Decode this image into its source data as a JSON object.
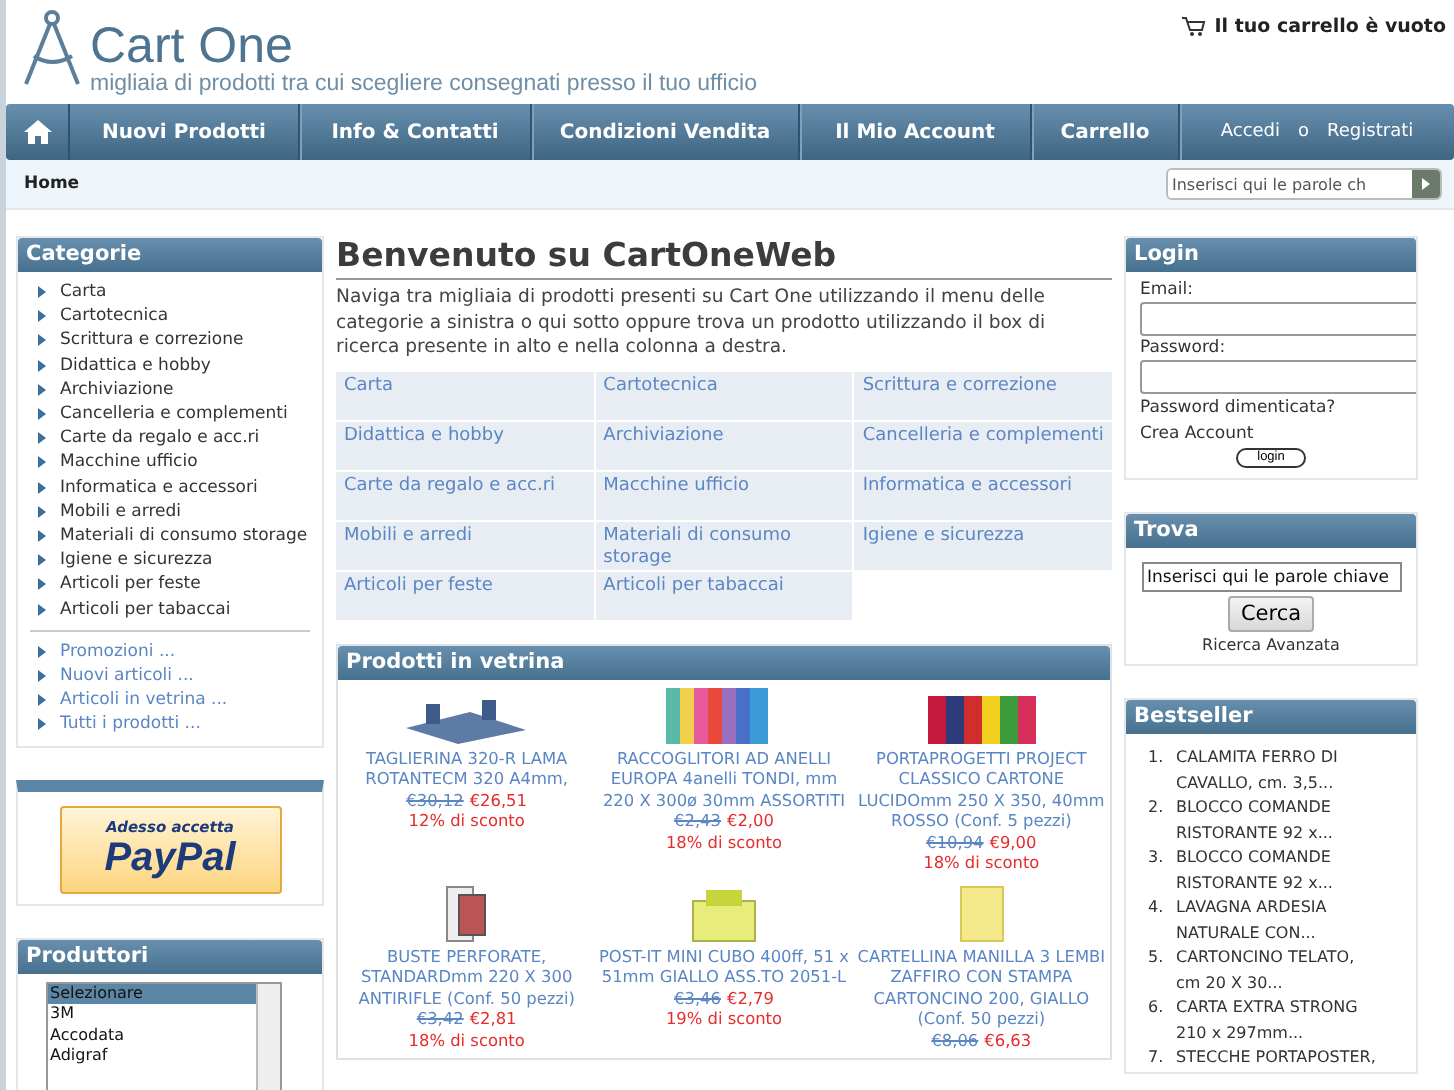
{
  "header": {
    "logo": "Cart One",
    "tagline": "migliaia di prodotti tra cui scegliere consegnati presso il tuo ufficio",
    "cart": "Il tuo carrello è vuoto"
  },
  "nav": {
    "items": [
      "Nuovi Prodotti",
      "Info & Contatti",
      "Condizioni Vendita",
      "Il Mio Account",
      "Carrello"
    ],
    "login": "Accedi",
    "separator": "o",
    "register": "Registrati"
  },
  "breadcrumb": "Home",
  "top_search": {
    "placeholder": "Inserisci qui le parole ch"
  },
  "categories": {
    "title": "Categorie",
    "items": [
      {
        "label": "Carta"
      },
      {
        "label": "Cartotecnica"
      },
      {
        "label": "Scrittura e correzione"
      },
      {
        "label": "Didattica e hobby"
      },
      {
        "label": "Archiviazione"
      },
      {
        "label": "Cancelleria e complementi"
      },
      {
        "label": "Carte da regalo e acc.ri"
      },
      {
        "label": "Macchine ufficio"
      },
      {
        "label": "Informatica e accessori"
      },
      {
        "label": "Mobili e arredi"
      },
      {
        "label": "Materiali di consumo storage"
      },
      {
        "label": "Igiene e sicurezza"
      },
      {
        "label": "Articoli per feste"
      },
      {
        "label": "Articoli per tabaccai"
      }
    ],
    "links": [
      "Promozioni ...",
      "Nuovi articoli ...",
      "Articoli in vetrina ...",
      "Tutti i prodotti ..."
    ]
  },
  "paypal": {
    "line1": "Adesso accetta",
    "line2": "PayPal"
  },
  "manufacturers": {
    "title": "Produttori",
    "options": [
      {
        "label": "Selezionare",
        "selected": true
      },
      {
        "label": "3M",
        "selected": false
      },
      {
        "label": "Accodata",
        "selected": false
      },
      {
        "label": "Adigraf",
        "selected": false
      }
    ]
  },
  "welcome": {
    "title": "Benvenuto su CartOneWeb",
    "text": "Naviga tra migliaia di prodotti presenti su Cart One utilizzando il menu delle categorie a sinistra o qui sotto oppure trova un prodotto utilizzando il box di ricerca presente in alto e nella colonna a destra."
  },
  "category_grid": [
    "Carta",
    "Cartotecnica",
    "Scrittura e correzione",
    "Didattica e hobby",
    "Archiviazione",
    "Cancelleria e complementi",
    "Carte da regalo e acc.ri",
    "Macchine ufficio",
    "Informatica e accessori",
    "Mobili e arredi",
    "Materiali di consumo storage",
    "Igiene e sicurezza",
    "Articoli per feste",
    "Articoli per tabaccai"
  ],
  "featured": {
    "title": "Prodotti in vetrina",
    "products": [
      {
        "name": "TAGLIERINA 320-R LAMA ROTANTECM 320 A4mm,",
        "old_price": "€30,12",
        "price": "€26,51",
        "discount": "12% di sconto",
        "kind": "cutter"
      },
      {
        "name": "RACCOGLITORI AD ANELLI EUROPA 4anelli TONDI, mm 220 X 300ø 30mm ASSORTITI",
        "old_price": "€2,43",
        "price": "€2,00",
        "discount": "18% di sconto",
        "kind": "binders"
      },
      {
        "name": "PORTAPROGETTI PROJECT CLASSICO CARTONE LUCIDOmm 250 X 350, 40mm ROSSO (Conf. 5 pezzi)",
        "old_price": "€10,94",
        "price": "€9,00",
        "discount": "18% di sconto",
        "kind": "boxes"
      },
      {
        "name": "BUSTE PERFORATE, STANDARDmm 220 X 300 ANTIRIFLE (Conf. 50 pezzi)",
        "old_price": "€3,42",
        "price": "€2,81",
        "discount": "18% di sconto",
        "kind": "sleeves"
      },
      {
        "name": "POST-IT MINI CUBO 400ff, 51 x 51mm GIALLO ASS.TO 2051-L",
        "old_price": "€3,46",
        "price": "€2,79",
        "discount": "19% di sconto",
        "kind": "notes"
      },
      {
        "name": "CARTELLINA MANILLA 3 LEMBI ZAFFIRO CON STAMPA CARTONCINO 200, GIALLO (Conf. 50 pezzi)",
        "old_price": "€8,06",
        "price": "€6,63",
        "kind": "folder"
      }
    ]
  },
  "login": {
    "title": "Login",
    "email_label": "Email:",
    "password_label": "Password:",
    "forgot": "Password dimenticata?",
    "create": "Crea Account",
    "button": "login"
  },
  "find": {
    "title": "Trova",
    "value": "Inserisci qui le parole chiave",
    "button": "Cerca",
    "advanced": "Ricerca Avanzata"
  },
  "bestseller": {
    "title": "Bestseller",
    "items": [
      {
        "number": "1.",
        "label": "CALAMITA FERRO DI CAVALLO, cm. 3,5..."
      },
      {
        "number": "2.",
        "label": "BLOCCO COMANDE RISTORANTE 92 x..."
      },
      {
        "number": "3.",
        "label": "BLOCCO COMANDE RISTORANTE 92 x..."
      },
      {
        "number": "4.",
        "label": "LAVAGNA ARDESIA NATURALE CON..."
      },
      {
        "number": "5.",
        "label": "CARTONCINO TELATO, cm 20 X 30..."
      },
      {
        "number": "6.",
        "label": "CARTA EXTRA STRONG 210 x 297mm..."
      },
      {
        "number": "7.",
        "label": "STECCHE PORTAPOSTER,"
      }
    ]
  }
}
